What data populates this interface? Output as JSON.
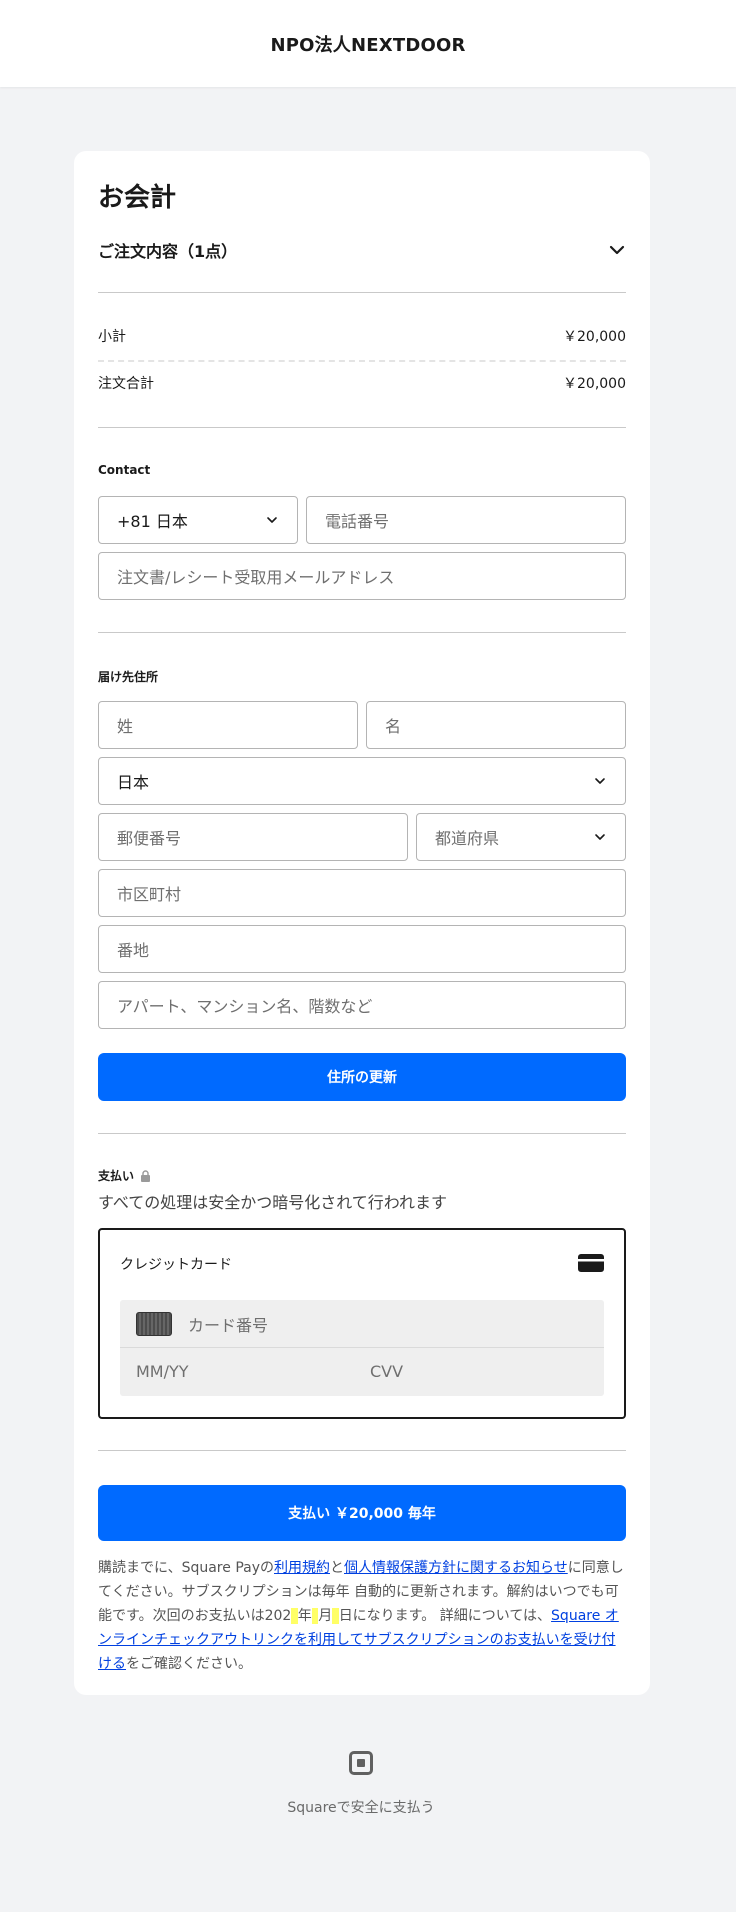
{
  "header": {
    "brand": "NPO法人NEXTDOOR"
  },
  "checkout": {
    "title": "お会計",
    "order_summary_label": "ご注文内容（1点）",
    "subtotal_label": "小計",
    "subtotal_value": "￥20,000",
    "total_label": "注文合計",
    "total_value": "￥20,000"
  },
  "contact": {
    "label": "Contact",
    "country_code": "+81 日本",
    "phone_placeholder": "電話番号",
    "email_placeholder": "注文書/レシート受取用メールアドレス"
  },
  "shipping": {
    "label": "届け先住所",
    "last_name_placeholder": "姓",
    "first_name_placeholder": "名",
    "country": "日本",
    "postal_placeholder": "郵便番号",
    "prefecture_placeholder": "都道府県",
    "city_placeholder": "市区町村",
    "street_placeholder": "番地",
    "apartment_placeholder": "アパート、マンション名、階数など",
    "update_button": "住所の更新"
  },
  "payment": {
    "label": "支払い",
    "secure_note": "すべての処理は安全かつ暗号化されて行われます",
    "method_label": "クレジットカード",
    "card_number_placeholder": "カード番号",
    "expiry_placeholder": "MM/YY",
    "cvv_placeholder": "CVV",
    "pay_button": "支払い ￥20,000 毎年"
  },
  "legal": {
    "t1": "購読までに、Square Payの",
    "link_terms": "利用規約",
    "t2": "と",
    "link_privacy": "個人情報保護方針に関するお知らせ",
    "t3": "に同意してください。サブスクリプションは毎年 自動的に更新されます。解約はいつでも可能です。次回のお支払いは202",
    "y": " ",
    "t4": "年",
    "m": " ",
    "t5": "月",
    "d": " ",
    "t6": "日になります。 詳細については、",
    "link_square": "Square オンラインチェックアウトリンクを利用してサブスクリプションのお支払いを受け付ける",
    "t7": "をご確認ください。"
  },
  "footer": {
    "text": "Squareで安全に支払う"
  },
  "colors": {
    "accent": "#006aff",
    "background": "#f2f3f5",
    "link": "#0040e0"
  },
  "icons": {
    "chevron": "chevron-down-icon",
    "lock": "lock-icon",
    "credit_card": "credit-card-icon",
    "square_logo": "square-logo-icon"
  }
}
